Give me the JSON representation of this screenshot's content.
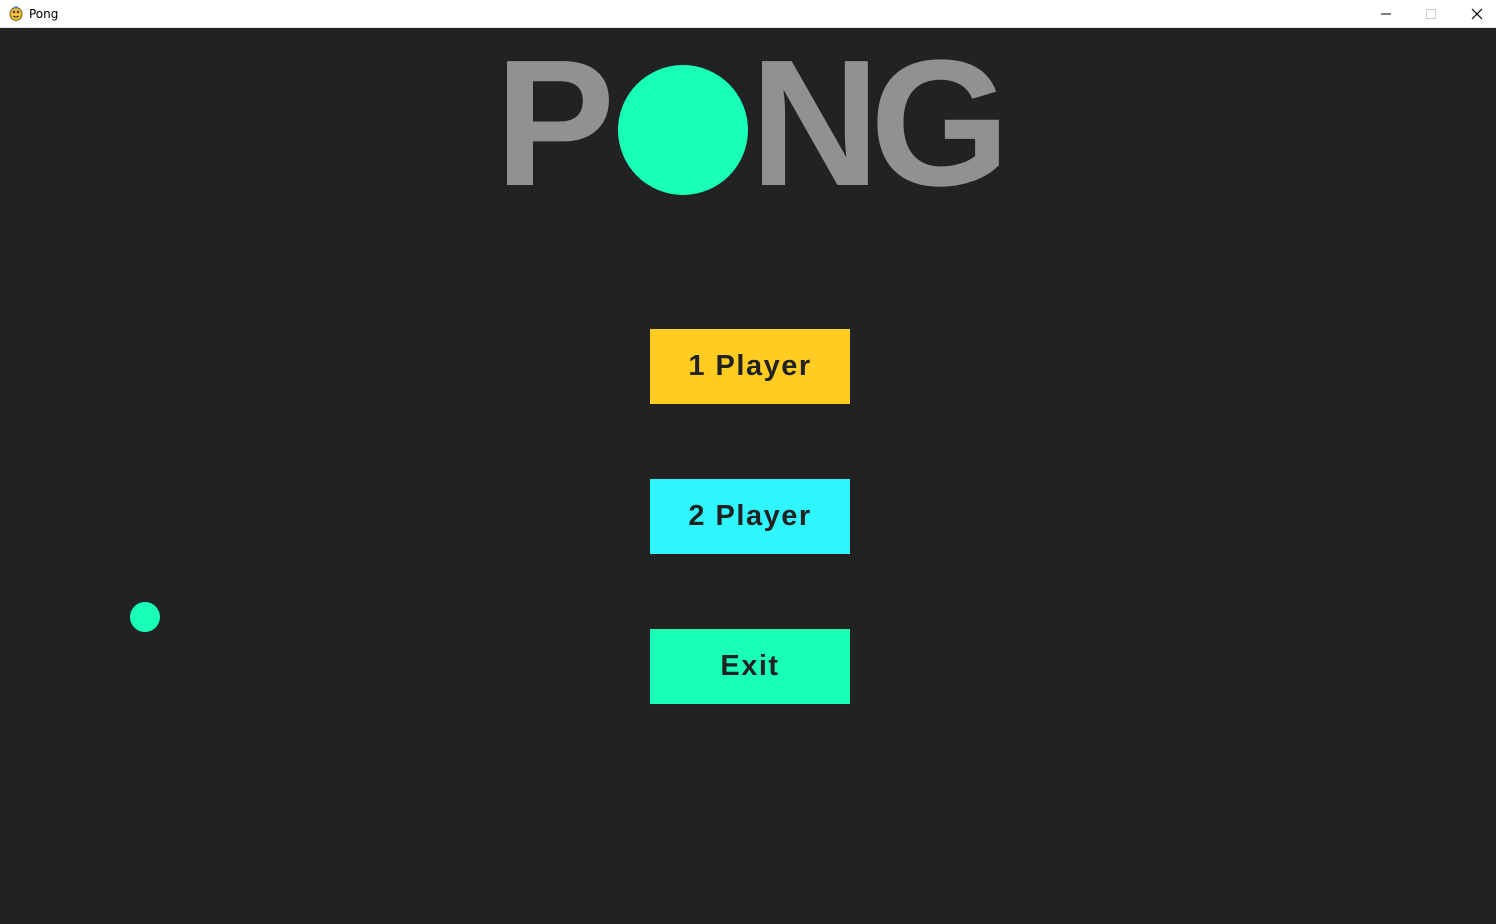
{
  "window": {
    "title": "Pong",
    "icon": "pygame-snake-icon",
    "controls": {
      "minimize_icon": "minimize-icon",
      "maximize_icon": "maximize-icon",
      "close_icon": "close-icon"
    }
  },
  "logo": {
    "letters": [
      "P",
      "N",
      "G"
    ],
    "ball_color": "#1affb7",
    "text_color": "#919191"
  },
  "menu": {
    "one_player": {
      "label": "1 Player",
      "color": "#ffcd22"
    },
    "two_player": {
      "label": "2 Player",
      "color": "#2ff5ff"
    },
    "exit": {
      "label": "Exit",
      "color": "#1affb7"
    }
  },
  "game": {
    "background": "#222222",
    "ball_color": "#1affb7"
  }
}
